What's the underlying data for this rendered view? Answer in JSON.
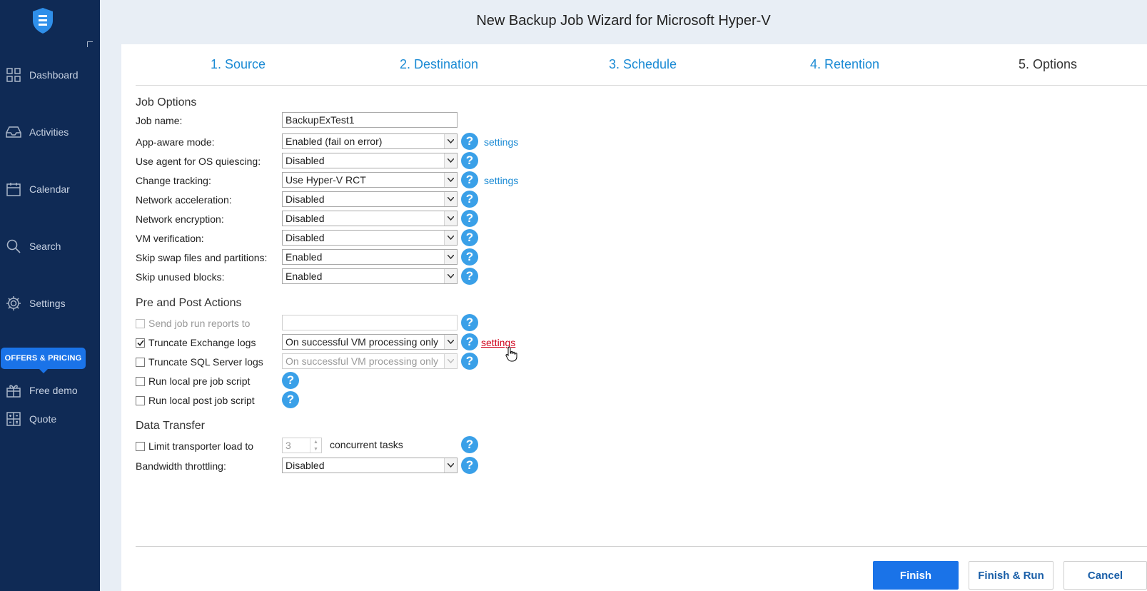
{
  "window": {
    "title": "New Backup Job Wizard for Microsoft Hyper-V"
  },
  "sidebar": {
    "items": [
      {
        "label": "Dashboard",
        "icon": "dashboard-icon"
      },
      {
        "label": "Activities",
        "icon": "inbox-icon"
      },
      {
        "label": "Calendar",
        "icon": "calendar-icon"
      },
      {
        "label": "Search",
        "icon": "search-icon"
      },
      {
        "label": "Settings",
        "icon": "gear-icon"
      }
    ],
    "offers": "OFFERS & PRICING",
    "extra": [
      {
        "label": "Free demo",
        "icon": "gift-icon"
      },
      {
        "label": "Quote",
        "icon": "calculator-icon"
      }
    ]
  },
  "steps": [
    "1. Source",
    "2. Destination",
    "3. Schedule",
    "4. Retention",
    "5. Options"
  ],
  "job_options": {
    "heading": "Job Options",
    "job_name_label": "Job name:",
    "job_name_value": "BackupExTest1",
    "rows": [
      {
        "label": "App-aware mode:",
        "value": "Enabled (fail on error)",
        "link": "settings"
      },
      {
        "label": "Use agent for OS quiescing:",
        "value": "Disabled"
      },
      {
        "label": "Change tracking:",
        "value": "Use Hyper-V RCT",
        "link": "settings"
      },
      {
        "label": "Network acceleration:",
        "value": "Disabled"
      },
      {
        "label": "Network encryption:",
        "value": "Disabled"
      },
      {
        "label": "VM verification:",
        "value": "Disabled"
      },
      {
        "label": "Skip swap files and partitions:",
        "value": "Enabled"
      },
      {
        "label": "Skip unused blocks:",
        "value": "Enabled"
      }
    ]
  },
  "pre_post": {
    "heading": "Pre and Post Actions",
    "send_reports": {
      "label": "Send job run reports to",
      "value": ""
    },
    "truncate_exchange": {
      "label": "Truncate Exchange logs",
      "value": "On successful VM processing only",
      "link": "settings",
      "checked": true
    },
    "truncate_sql": {
      "label": "Truncate SQL Server logs",
      "value": "On successful VM processing only",
      "checked": false
    },
    "pre_script": {
      "label": "Run local pre job script",
      "checked": false
    },
    "post_script": {
      "label": "Run local post job script",
      "checked": false
    }
  },
  "data_transfer": {
    "heading": "Data Transfer",
    "limit_label": "Limit transporter load to",
    "limit_value": "3",
    "limit_suffix": "concurrent tasks",
    "bandwidth_label": "Bandwidth throttling:",
    "bandwidth_value": "Disabled"
  },
  "footer": {
    "finish": "Finish",
    "finish_run": "Finish & Run",
    "cancel": "Cancel"
  },
  "help_glyph": "?",
  "colors": {
    "sidebar": "#0f2a55",
    "accent": "#1a73e8",
    "link": "#1a8ad4",
    "help": "#3aa0e8",
    "hover_link": "#d0021b"
  }
}
